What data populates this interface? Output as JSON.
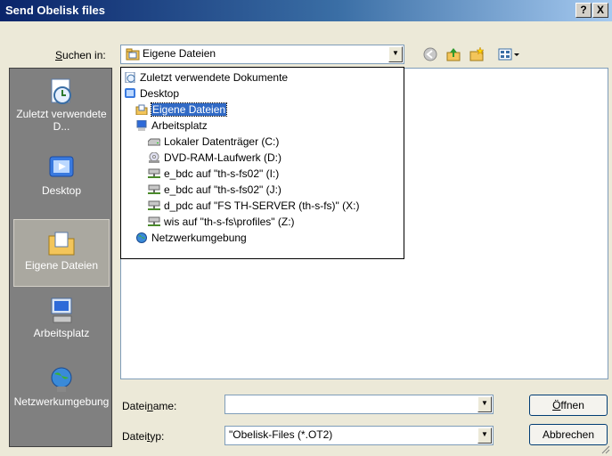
{
  "window": {
    "title": "Send Obelisk files",
    "help_button": "?",
    "close_button": "X"
  },
  "lookin": {
    "label_prefix": "",
    "label_mnemonic": "S",
    "label_rest": "uchen in:",
    "value": "Eigene Dateien"
  },
  "toolbar": {
    "icons": [
      "back-icon",
      "up-folder-icon",
      "new-folder-icon",
      "view-menu-icon"
    ]
  },
  "dropdown": {
    "items": [
      {
        "label": "Zuletzt verwendete Dokumente",
        "icon": "recent-icon",
        "indent": 0
      },
      {
        "label": "Desktop",
        "icon": "desktop-icon",
        "indent": 0
      },
      {
        "label": "Eigene Dateien",
        "icon": "my-documents-icon",
        "indent": 1,
        "selected": true
      },
      {
        "label": "Arbeitsplatz",
        "icon": "my-computer-icon",
        "indent": 1
      },
      {
        "label": "Lokaler Datenträger (C:)",
        "icon": "drive-icon",
        "indent": 2
      },
      {
        "label": "DVD-RAM-Laufwerk (D:)",
        "icon": "dvd-icon",
        "indent": 2
      },
      {
        "label": "e_bdc auf \"th-s-fs02\" (I:)",
        "icon": "network-drive-icon",
        "indent": 2
      },
      {
        "label": "e_bdc auf \"th-s-fs02\" (J:)",
        "icon": "network-drive-icon",
        "indent": 2
      },
      {
        "label": "d_pdc auf \"FS TH-SERVER (th-s-fs)\" (X:)",
        "icon": "network-drive-icon",
        "indent": 2
      },
      {
        "label": "wis auf \"th-s-fs\\profiles\" (Z:)",
        "icon": "network-drive-icon",
        "indent": 2
      },
      {
        "label": "Netzwerkumgebung",
        "icon": "network-places-icon",
        "indent": 1
      }
    ]
  },
  "places": [
    {
      "label": "Zuletzt verwendete D...",
      "icon": "recent-documents-icon"
    },
    {
      "label": "Desktop",
      "icon": "desktop-icon"
    },
    {
      "label": "Eigene Dateien",
      "icon": "my-documents-icon",
      "selected": true
    },
    {
      "label": "Arbeitsplatz",
      "icon": "my-computer-icon"
    },
    {
      "label": "Netzwerkumgebung",
      "icon": "network-places-icon"
    }
  ],
  "filename": {
    "label_prefix": "Datei",
    "label_mnemonic": "n",
    "label_rest": "ame:",
    "value": ""
  },
  "filetype": {
    "label_prefix": "Datei",
    "label_mnemonic": "t",
    "label_rest": "yp:",
    "value": "\"Obelisk-Files (*.OT2)"
  },
  "buttons": {
    "open_mnemonic": "Ö",
    "open_rest": "ffnen",
    "cancel": "Abbrechen"
  },
  "colors": {
    "title_start": "#0a246a",
    "title_end": "#a6caf0",
    "selection": "#316ac5"
  }
}
